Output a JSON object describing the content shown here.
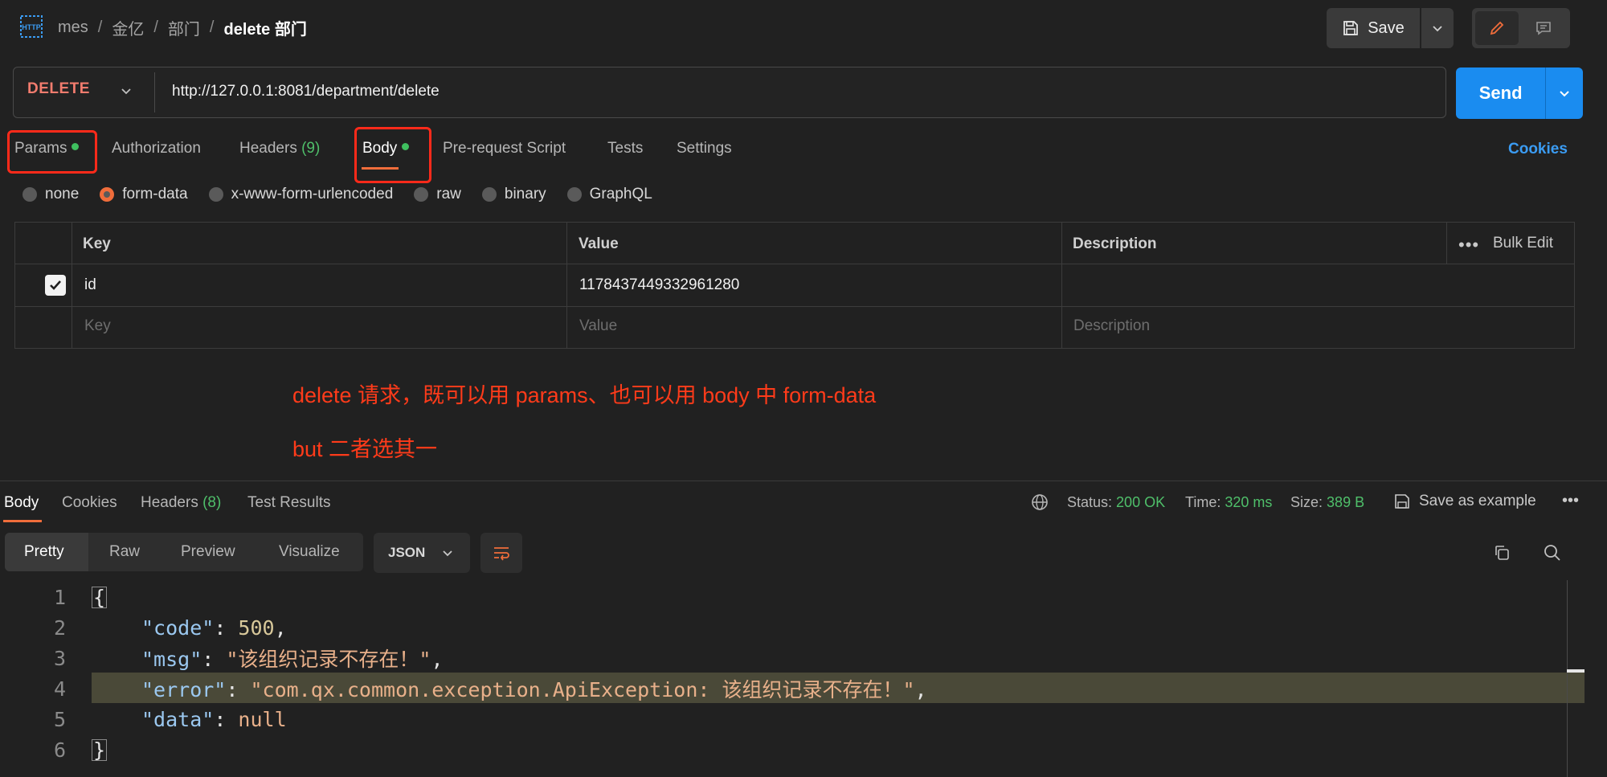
{
  "breadcrumb": {
    "items": [
      "mes",
      "金亿",
      "部门"
    ],
    "current": "delete 部门",
    "separator": "/"
  },
  "toolbar": {
    "save_label": "Save"
  },
  "request": {
    "method": "DELETE",
    "url": "http://127.0.0.1:8081/department/delete",
    "send_label": "Send",
    "tabs": [
      {
        "label": "Params",
        "has_dot": true
      },
      {
        "label": "Authorization"
      },
      {
        "label": "Headers",
        "count": "(9)"
      },
      {
        "label": "Body",
        "has_dot": true
      },
      {
        "label": "Pre-request Script"
      },
      {
        "label": "Tests"
      },
      {
        "label": "Settings"
      }
    ],
    "cookies_label": "Cookies"
  },
  "body_types": [
    "none",
    "form-data",
    "x-www-form-urlencoded",
    "raw",
    "binary",
    "GraphQL"
  ],
  "body_type_selected": "form-data",
  "form_table": {
    "headers": {
      "key": "Key",
      "value": "Value",
      "description": "Description",
      "bulk_edit": "Bulk Edit"
    },
    "rows": [
      {
        "checked": true,
        "key": "id",
        "value": "1178437449332961280",
        "description": ""
      }
    ],
    "placeholders": {
      "key": "Key",
      "value": "Value",
      "description": "Description"
    }
  },
  "annotation": {
    "line1": "delete 请求，既可以用 params、也可以用 body 中 form-data",
    "line2": "but 二者选其一"
  },
  "response": {
    "tabs": [
      {
        "label": "Body"
      },
      {
        "label": "Cookies"
      },
      {
        "label": "Headers",
        "count": "(8)"
      },
      {
        "label": "Test Results"
      }
    ],
    "status_label": "Status:",
    "status_value": "200 OK",
    "time_label": "Time:",
    "time_value": "320 ms",
    "size_label": "Size:",
    "size_value": "389 B",
    "save_example_label": "Save as example",
    "views": [
      "Pretty",
      "Raw",
      "Preview",
      "Visualize"
    ],
    "format": "JSON",
    "code_lines": [
      {
        "n": "1",
        "text": "{"
      },
      {
        "n": "2",
        "key": "\"code\"",
        "colon": ": ",
        "val": "500",
        "end": ","
      },
      {
        "n": "3",
        "key": "\"msg\"",
        "colon": ": ",
        "val": "\"该组织记录不存在！\"",
        "end": ","
      },
      {
        "n": "4",
        "key": "\"error\"",
        "colon": ": ",
        "val": "\"com.qx.common.exception.ApiException: 该组织记录不存在！\"",
        "end": ","
      },
      {
        "n": "5",
        "key": "\"data\"",
        "colon": ": ",
        "val": "null",
        "end": ""
      },
      {
        "n": "6",
        "text": "}"
      }
    ]
  },
  "colors": {
    "accent": "#f06d3b",
    "send": "#1a8cf0",
    "method": "#f27c6e",
    "annotation": "#ff3b1a",
    "status_green": "#4fbf6a"
  }
}
